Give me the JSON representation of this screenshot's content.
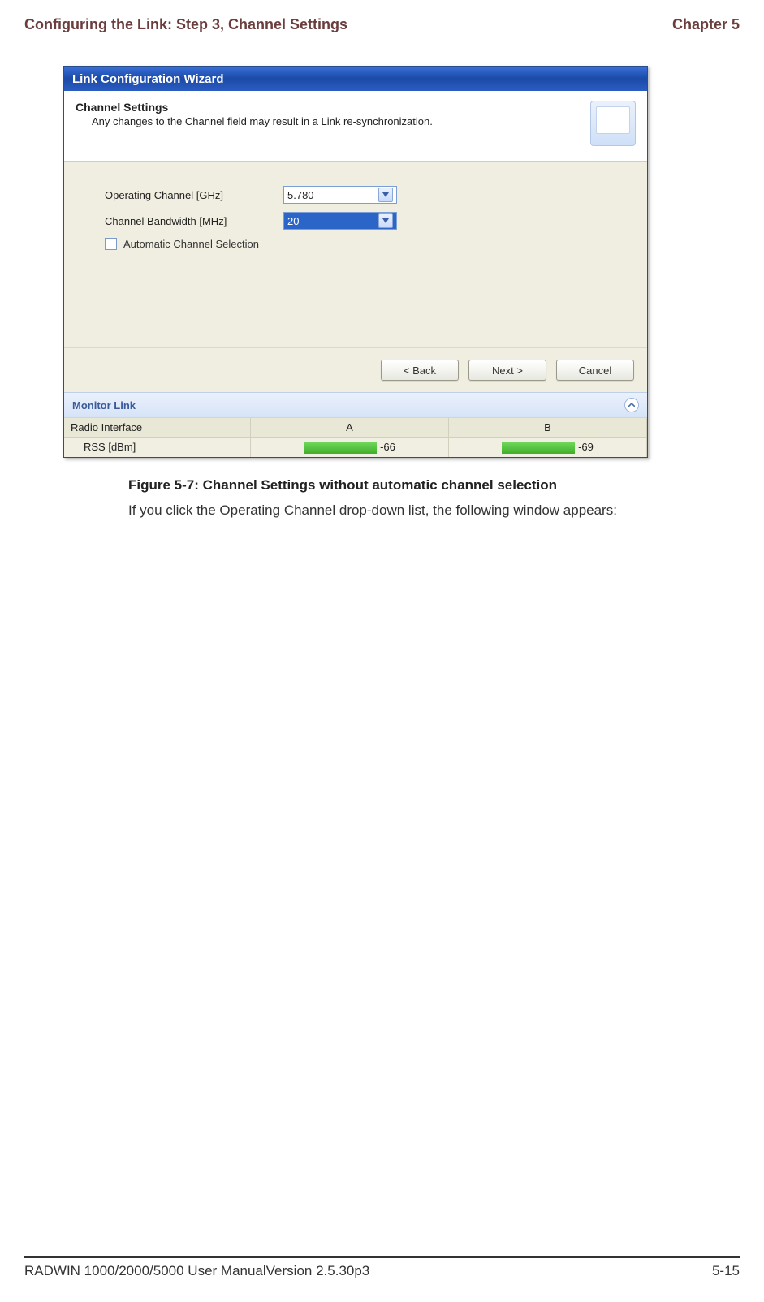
{
  "header": {
    "left": "Configuring the Link: Step 3, Channel Settings",
    "right": "Chapter 5"
  },
  "wizard": {
    "title": "Link Configuration Wizard",
    "section_title": "Channel Settings",
    "section_desc": "Any changes to the Channel field may result in a Link re-synchronization.",
    "fields": {
      "op_channel_label": "Operating Channel [GHz]",
      "op_channel_value": "5.780",
      "bandwidth_label": "Channel Bandwidth [MHz]",
      "bandwidth_value": "20",
      "acs_label": "Automatic Channel Selection"
    },
    "buttons": {
      "back": "< Back",
      "next": "Next >",
      "cancel": "Cancel"
    },
    "monitor": {
      "title": "Monitor Link",
      "iface_label": "Radio Interface",
      "colA": "A",
      "colB": "B",
      "rss_label": "RSS [dBm]",
      "rssA": "-66",
      "rssB": "-69"
    }
  },
  "caption": "Figure 5-7: Channel Settings without automatic channel selection",
  "body": "If you click the Operating Channel drop-down list, the following window appears:",
  "footer": {
    "left": "RADWIN 1000/2000/5000 User ManualVersion  2.5.30p3",
    "right": "5-15"
  }
}
